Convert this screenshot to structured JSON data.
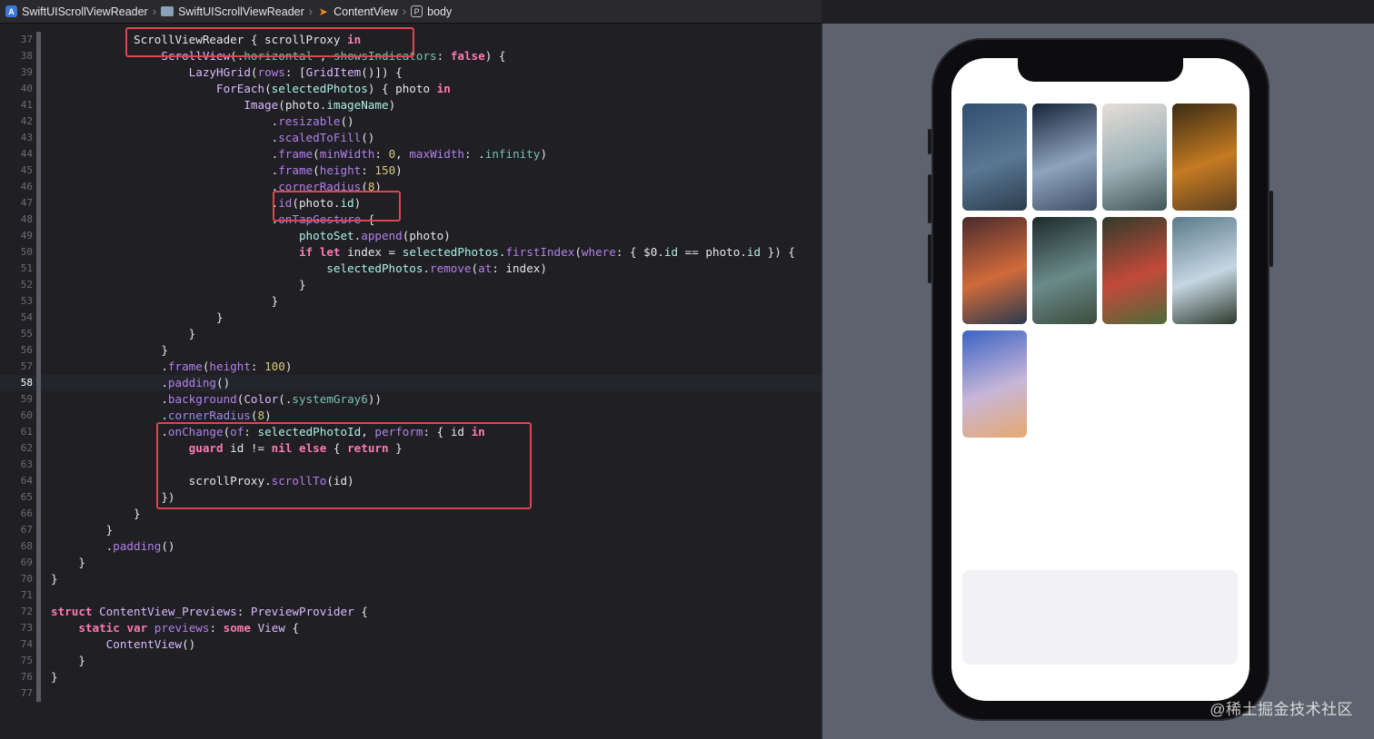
{
  "breadcrumb": [
    {
      "label": "SwiftUIScrollViewReader",
      "icon": "app-icon"
    },
    {
      "label": "SwiftUIScrollViewReader",
      "icon": "folder-icon"
    },
    {
      "label": "ContentView",
      "icon": "swift-file-icon"
    },
    {
      "label": "body",
      "icon": "property-icon"
    }
  ],
  "editor": {
    "current_line": 58,
    "lines": [
      {
        "n": "37",
        "tokens": [
          [
            "",
            "            "
          ],
          [
            "",
            "ScrollViewReader { scrollProxy "
          ],
          [
            "kw",
            "in"
          ]
        ]
      },
      {
        "n": "38",
        "tokens": [
          [
            "",
            "                "
          ],
          [
            "ty",
            "ScrollView"
          ],
          [
            "",
            "(."
          ],
          [
            "pl",
            "horizontal"
          ],
          [
            "",
            " , "
          ],
          [
            "pl",
            "showsIndicators"
          ],
          [
            "",
            ": "
          ],
          [
            "kw",
            "false"
          ],
          [
            "",
            ") {"
          ]
        ]
      },
      {
        "n": "39",
        "tokens": [
          [
            "",
            "                    "
          ],
          [
            "ty",
            "LazyHGrid"
          ],
          [
            "",
            "("
          ],
          [
            "pm",
            "rows"
          ],
          [
            "",
            ": ["
          ],
          [
            "ty",
            "GridItem"
          ],
          [
            "",
            "()]) {"
          ]
        ]
      },
      {
        "n": "40",
        "tokens": [
          [
            "",
            "                        "
          ],
          [
            "ty",
            "ForEach"
          ],
          [
            "",
            "("
          ],
          [
            "pj",
            "selectedPhotos"
          ],
          [
            "",
            ") { photo "
          ],
          [
            "kw",
            "in"
          ]
        ]
      },
      {
        "n": "41",
        "tokens": [
          [
            "",
            "                            "
          ],
          [
            "ty",
            "Image"
          ],
          [
            "",
            "(photo."
          ],
          [
            "pj",
            "imageName"
          ],
          [
            "",
            ")"
          ]
        ]
      },
      {
        "n": "42",
        "tokens": [
          [
            "",
            "                                ."
          ],
          [
            "fn",
            "resizable"
          ],
          [
            "",
            "()"
          ]
        ]
      },
      {
        "n": "43",
        "tokens": [
          [
            "",
            "                                ."
          ],
          [
            "fn",
            "scaledToFill"
          ],
          [
            "",
            "()"
          ]
        ]
      },
      {
        "n": "44",
        "tokens": [
          [
            "",
            "                                ."
          ],
          [
            "fn",
            "frame"
          ],
          [
            "",
            "("
          ],
          [
            "pm",
            "minWidth"
          ],
          [
            "",
            ": "
          ],
          [
            "nm",
            "0"
          ],
          [
            "",
            ", "
          ],
          [
            "pm",
            "maxWidth"
          ],
          [
            "",
            ": ."
          ],
          [
            "pl",
            "infinity"
          ],
          [
            "",
            ")"
          ]
        ]
      },
      {
        "n": "45",
        "tokens": [
          [
            "",
            "                                ."
          ],
          [
            "fn",
            "frame"
          ],
          [
            "",
            "("
          ],
          [
            "pm",
            "height"
          ],
          [
            "",
            ": "
          ],
          [
            "nm",
            "150"
          ],
          [
            "",
            ")"
          ]
        ]
      },
      {
        "n": "46",
        "tokens": [
          [
            "",
            "                                ."
          ],
          [
            "fn",
            "cornerRadius"
          ],
          [
            "",
            "("
          ],
          [
            "nm",
            "8"
          ],
          [
            "",
            ")"
          ]
        ]
      },
      {
        "n": "47",
        "tokens": [
          [
            "",
            "                                ."
          ],
          [
            "fn",
            "id"
          ],
          [
            "",
            "(photo."
          ],
          [
            "pj",
            "id"
          ],
          [
            "",
            ")"
          ]
        ]
      },
      {
        "n": "48",
        "tokens": [
          [
            "",
            "                                ."
          ],
          [
            "fn",
            "onTapGesture"
          ],
          [
            "",
            " {"
          ]
        ]
      },
      {
        "n": "49",
        "tokens": [
          [
            "",
            "                                    "
          ],
          [
            "pj",
            "photoSet"
          ],
          [
            "",
            "."
          ],
          [
            "fn",
            "append"
          ],
          [
            "",
            "(photo)"
          ]
        ]
      },
      {
        "n": "50",
        "tokens": [
          [
            "",
            "                                    "
          ],
          [
            "kw",
            "if"
          ],
          [
            "",
            " "
          ],
          [
            "kw",
            "let"
          ],
          [
            "",
            " index = "
          ],
          [
            "pj",
            "selectedPhotos"
          ],
          [
            "",
            "."
          ],
          [
            "fn",
            "firstIndex"
          ],
          [
            "",
            "("
          ],
          [
            "pm",
            "where"
          ],
          [
            "",
            ": { $0."
          ],
          [
            "pj",
            "id"
          ],
          [
            "",
            " == photo."
          ],
          [
            "pj",
            "id"
          ],
          [
            "",
            " }) {"
          ]
        ]
      },
      {
        "n": "51",
        "tokens": [
          [
            "",
            "                                        "
          ],
          [
            "pj",
            "selectedPhotos"
          ],
          [
            "",
            "."
          ],
          [
            "fn",
            "remove"
          ],
          [
            "",
            "("
          ],
          [
            "pm",
            "at"
          ],
          [
            "",
            ": index)"
          ]
        ]
      },
      {
        "n": "52",
        "tokens": [
          [
            "",
            "                                    }"
          ]
        ]
      },
      {
        "n": "53",
        "tokens": [
          [
            "",
            "                                }"
          ]
        ]
      },
      {
        "n": "54",
        "tokens": [
          [
            "",
            "                        }"
          ]
        ]
      },
      {
        "n": "55",
        "tokens": [
          [
            "",
            "                    }"
          ]
        ]
      },
      {
        "n": "56",
        "tokens": [
          [
            "",
            "                }"
          ]
        ]
      },
      {
        "n": "57",
        "tokens": [
          [
            "",
            "                ."
          ],
          [
            "fn",
            "frame"
          ],
          [
            "",
            "("
          ],
          [
            "pm",
            "height"
          ],
          [
            "",
            ": "
          ],
          [
            "nm",
            "100"
          ],
          [
            "",
            ")"
          ]
        ]
      },
      {
        "n": "58",
        "tokens": [
          [
            "",
            "                ."
          ],
          [
            "fn",
            "padding"
          ],
          [
            "",
            "()"
          ]
        ]
      },
      {
        "n": "59",
        "tokens": [
          [
            "",
            "                ."
          ],
          [
            "fn",
            "background"
          ],
          [
            "",
            "("
          ],
          [
            "ty",
            "Color"
          ],
          [
            "",
            "(."
          ],
          [
            "pl",
            "systemGray6"
          ],
          [
            "",
            "))"
          ]
        ]
      },
      {
        "n": "60",
        "tokens": [
          [
            "",
            "                ."
          ],
          [
            "fn",
            "cornerRadius"
          ],
          [
            "",
            "("
          ],
          [
            "nm",
            "8"
          ],
          [
            "",
            ")"
          ]
        ]
      },
      {
        "n": "61",
        "tokens": [
          [
            "",
            "                ."
          ],
          [
            "fn",
            "onChange"
          ],
          [
            "",
            "("
          ],
          [
            "pm",
            "of"
          ],
          [
            "",
            ": "
          ],
          [
            "pj",
            "selectedPhotoId"
          ],
          [
            "",
            ", "
          ],
          [
            "pm",
            "perform"
          ],
          [
            "",
            ": { id "
          ],
          [
            "kw",
            "in"
          ]
        ]
      },
      {
        "n": "62",
        "tokens": [
          [
            "",
            "                    "
          ],
          [
            "kw",
            "guard"
          ],
          [
            "",
            " id != "
          ],
          [
            "kw",
            "nil"
          ],
          [
            "",
            " "
          ],
          [
            "kw",
            "else"
          ],
          [
            "",
            " { "
          ],
          [
            "kw",
            "return"
          ],
          [
            "",
            " }"
          ]
        ]
      },
      {
        "n": "63",
        "tokens": [
          [
            "",
            ""
          ]
        ]
      },
      {
        "n": "64",
        "tokens": [
          [
            "",
            "                    scrollProxy."
          ],
          [
            "fn",
            "scrollTo"
          ],
          [
            "",
            "(id)"
          ]
        ]
      },
      {
        "n": "65",
        "tokens": [
          [
            "",
            "                })"
          ]
        ]
      },
      {
        "n": "66",
        "tokens": [
          [
            "",
            "            }"
          ]
        ]
      },
      {
        "n": "67",
        "tokens": [
          [
            "",
            "        }"
          ]
        ]
      },
      {
        "n": "68",
        "tokens": [
          [
            "",
            "        ."
          ],
          [
            "fn",
            "padding"
          ],
          [
            "",
            "()"
          ]
        ]
      },
      {
        "n": "69",
        "tokens": [
          [
            "",
            "    }"
          ]
        ]
      },
      {
        "n": "70",
        "tokens": [
          [
            "",
            "}"
          ]
        ]
      },
      {
        "n": "71",
        "tokens": [
          [
            "",
            ""
          ]
        ]
      },
      {
        "n": "72",
        "tokens": [
          [
            "kw",
            "struct"
          ],
          [
            "",
            " "
          ],
          [
            "ty",
            "ContentView_Previews"
          ],
          [
            "",
            ": "
          ],
          [
            "ty",
            "PreviewProvider"
          ],
          [
            "",
            " {"
          ]
        ]
      },
      {
        "n": "73",
        "tokens": [
          [
            "",
            "    "
          ],
          [
            "kw",
            "static"
          ],
          [
            "",
            " "
          ],
          [
            "kw",
            "var"
          ],
          [
            "",
            " "
          ],
          [
            "pm",
            "previews"
          ],
          [
            "",
            ": "
          ],
          [
            "kw",
            "some"
          ],
          [
            "",
            " "
          ],
          [
            "ty",
            "View"
          ],
          [
            "",
            " {"
          ]
        ]
      },
      {
        "n": "74",
        "tokens": [
          [
            "",
            "        "
          ],
          [
            "ty",
            "ContentView"
          ],
          [
            "",
            "()"
          ]
        ]
      },
      {
        "n": "75",
        "tokens": [
          [
            "",
            "    }"
          ]
        ]
      },
      {
        "n": "76",
        "tokens": [
          [
            "",
            "}"
          ]
        ]
      },
      {
        "n": "77",
        "tokens": [
          [
            "",
            ""
          ]
        ]
      }
    ]
  },
  "colors": {
    "highlight": "#e04450",
    "photos": [
      [
        "#2f4e6e",
        "#5a7794",
        "#2b3d4c"
      ],
      [
        "#16243a",
        "#8fa3bd",
        "#3e4f66"
      ],
      [
        "#e6ded8",
        "#9bb0b6",
        "#3f5556"
      ],
      [
        "#3a2b14",
        "#c47a22",
        "#5a4020"
      ],
      [
        "#4a2a2e",
        "#d06a3a",
        "#2a3a4e"
      ],
      [
        "#1e2a2a",
        "#6a8a8a",
        "#3b4c3c"
      ],
      [
        "#2f3b2a",
        "#c24a3a",
        "#4d6a3a"
      ],
      [
        "#5a7a8a",
        "#c6d6e2",
        "#2e3a2e"
      ],
      [
        "#3b63c4",
        "#c8b6d8",
        "#e6a970"
      ]
    ]
  },
  "watermark": "@稀土掘金技术社区"
}
